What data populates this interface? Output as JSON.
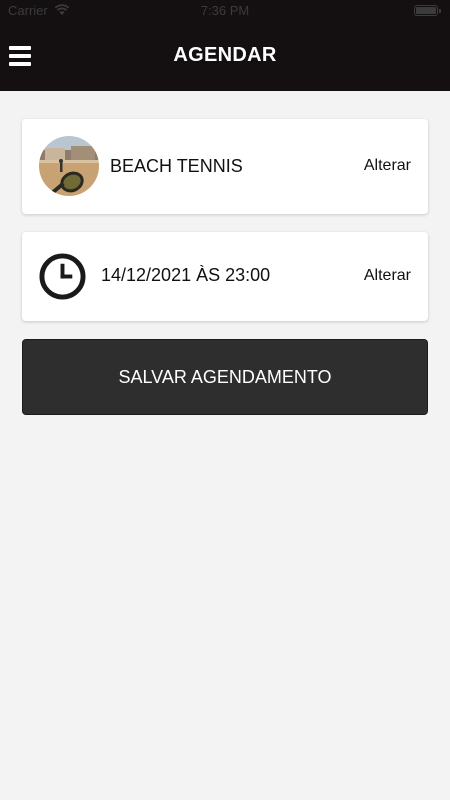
{
  "status_bar": {
    "carrier": "Carrier",
    "time": "7:36 PM"
  },
  "header": {
    "title": "AGENDAR"
  },
  "sport": {
    "name": "BEACH TENNIS",
    "change_label": "Alterar"
  },
  "schedule": {
    "datetime": "14/12/2021 ÀS 23:00",
    "change_label": "Alterar"
  },
  "actions": {
    "save_label": "SALVAR AGENDAMENTO"
  },
  "colors": {
    "header_bg": "#141011",
    "button_bg": "#2e2e2e",
    "page_bg": "#f3f3f3"
  },
  "icons": {
    "menu": "hamburger-menu-icon",
    "clock": "clock-icon",
    "wifi": "wifi-icon",
    "battery": "battery-icon"
  }
}
